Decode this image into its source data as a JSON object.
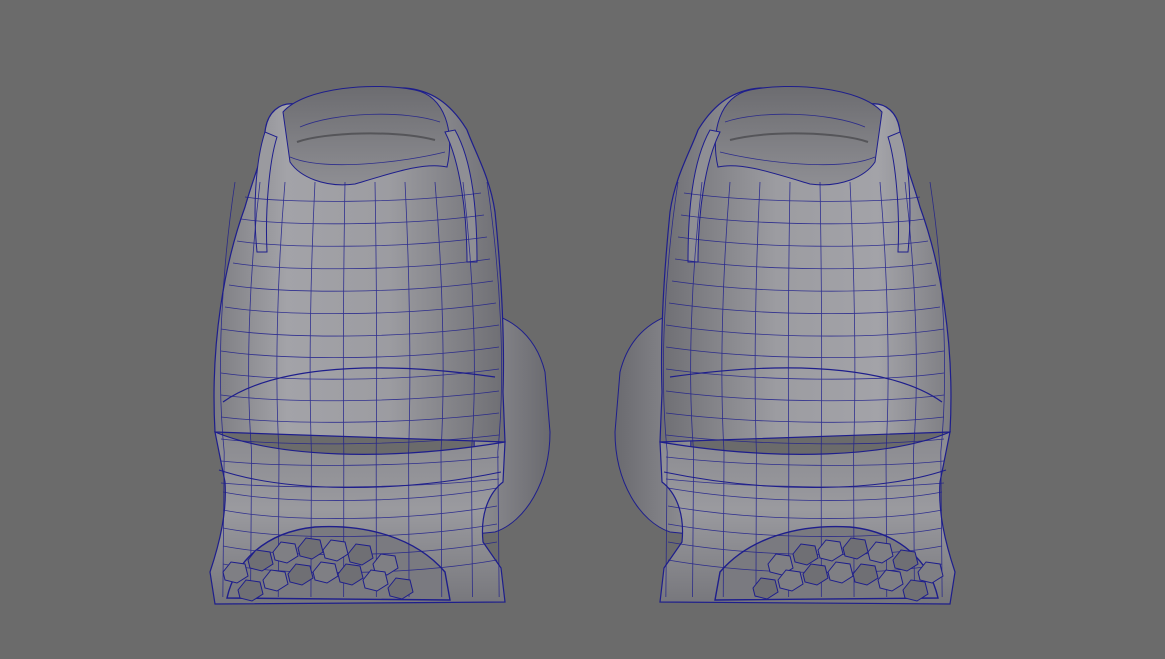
{
  "viewport": {
    "background_color": "#6b6b6b",
    "wire_color": "#1e1e8c",
    "surface_light": "#a6a6ab",
    "surface_mid": "#8c8c91",
    "surface_dark": "#5f5f64",
    "interior_color": "#7a7a7e",
    "objects": [
      {
        "name": "left-shoe"
      },
      {
        "name": "right-shoe"
      }
    ]
  }
}
